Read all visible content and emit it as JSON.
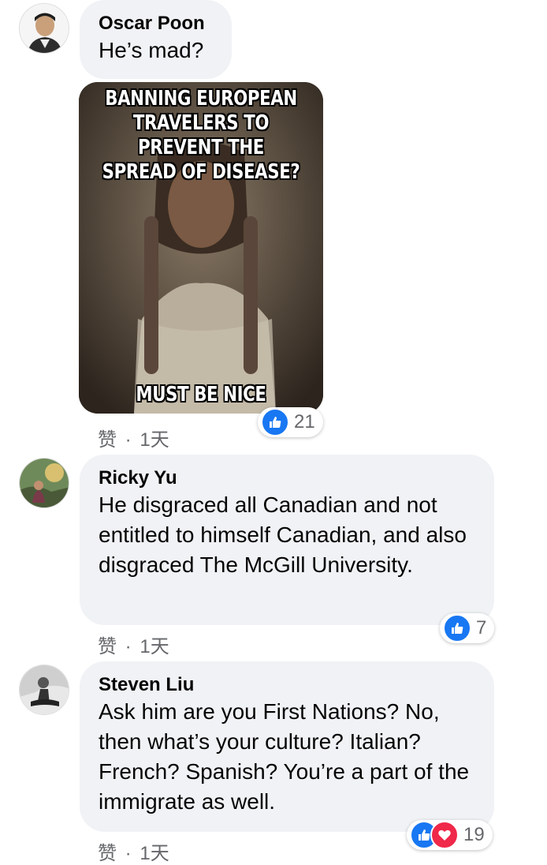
{
  "comments": [
    {
      "author": "Oscar Poon",
      "text": "He’s mad?",
      "meme": {
        "top_text": "BANNING EUROPEAN TRAVELERS TO PREVENT THE SPREAD OF DISEASE?",
        "bottom_text": "MUST BE NICE"
      },
      "like_label": "赞",
      "separator": "·",
      "time": "1天",
      "reaction_count": "21"
    },
    {
      "author": "Ricky Yu",
      "text": "He disgraced all Canadian and not entitled to himself Canadian, and also disgraced The McGill University.",
      "like_label": "赞",
      "separator": "·",
      "time": "1天",
      "reaction_count": "7"
    },
    {
      "author": "Steven Liu",
      "text": "Ask him are you First Nations? No, then what’s your culture? Italian? French? Spanish? You’re a part of the immigrate as well.",
      "like_label": "赞",
      "separator": "·",
      "time": "1天",
      "reaction_count": "19"
    }
  ],
  "colors": {
    "bubble": "#f0f2f5",
    "like": "#1877f2",
    "love": "#f02849",
    "meta": "#65676b"
  }
}
